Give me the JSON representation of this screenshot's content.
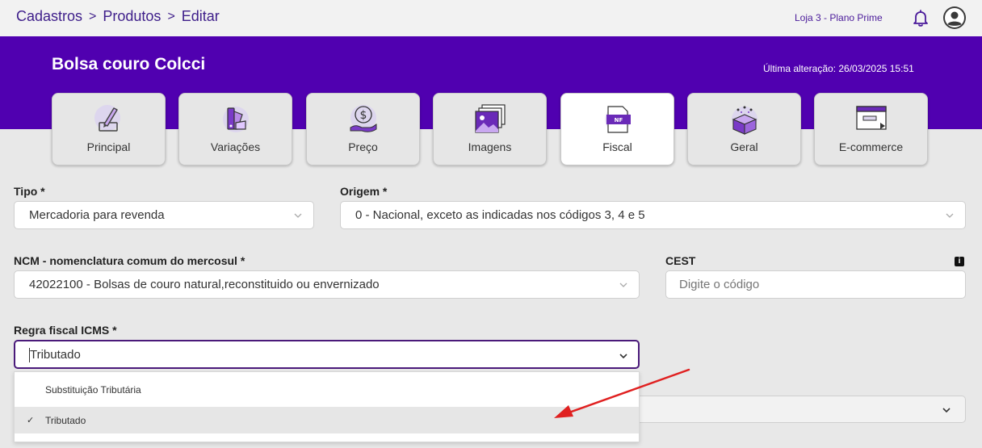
{
  "breadcrumb": {
    "items": [
      "Cadastros",
      "Produtos",
      "Editar"
    ],
    "separator": ">"
  },
  "header": {
    "store": "Loja 3 - Plano Prime"
  },
  "product": {
    "title": "Bolsa couro Colcci",
    "last_change": "Última alteração: 26/03/2025 15:51"
  },
  "tabs": [
    {
      "label": "Principal",
      "icon": "edit-document-icon"
    },
    {
      "label": "Variações",
      "icon": "color-palette-icon"
    },
    {
      "label": "Preço",
      "icon": "dollar-hand-icon"
    },
    {
      "label": "Imagens",
      "icon": "image-gallery-icon"
    },
    {
      "label": "Fiscal",
      "icon": "nf-document-icon",
      "active": true
    },
    {
      "label": "Geral",
      "icon": "box-sparkle-icon"
    },
    {
      "label": "E-commerce",
      "icon": "browser-window-icon"
    }
  ],
  "form": {
    "tipo": {
      "label": "Tipo *",
      "value": "Mercadoria para revenda"
    },
    "origem": {
      "label": "Origem *",
      "value": "0 - Nacional, exceto as indicadas nos códigos 3, 4 e 5"
    },
    "ncm": {
      "label": "NCM - nomenclatura comum do mercosul *",
      "value": "42022100 - Bolsas de couro natural,reconstituido ou envernizado"
    },
    "cest": {
      "label": "CEST",
      "placeholder": "Digite o código"
    },
    "icms": {
      "label": "Regra fiscal ICMS *",
      "value": "Tributado"
    }
  },
  "dropdown": {
    "options": [
      {
        "label": "Substituição Tributária",
        "selected": false
      },
      {
        "label": "Tributado",
        "selected": true
      }
    ],
    "check_glyph": "✓"
  },
  "colors": {
    "brand": "#5000b0",
    "annotation_arrow": "#e02020"
  }
}
